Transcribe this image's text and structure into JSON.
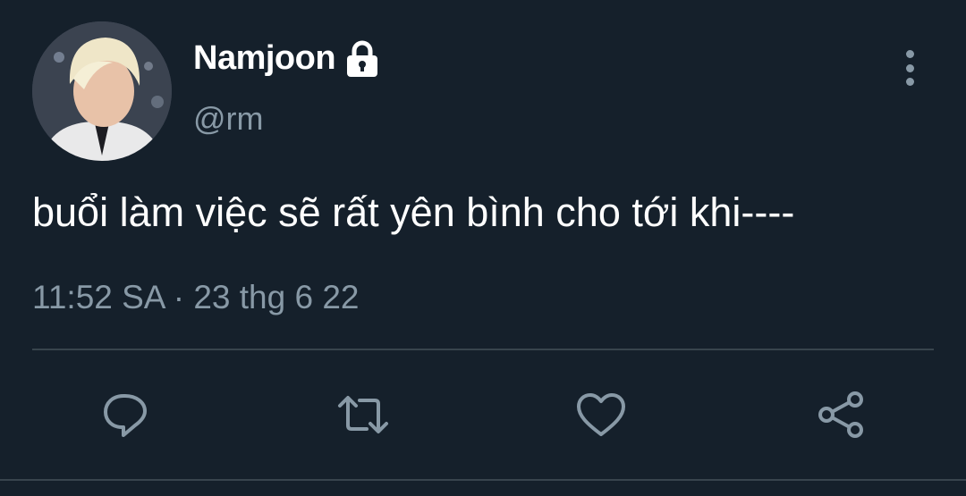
{
  "tweet": {
    "display_name": "Namjoon",
    "handle": "@rm",
    "protected_icon": "lock-icon",
    "text": "buổi làm việc sẽ rất yên bình cho tới khi----",
    "timestamp": "11:52 SA · 23 thg 6 22"
  },
  "actions": [
    {
      "name": "reply",
      "icon": "reply-icon"
    },
    {
      "name": "retweet",
      "icon": "retweet-icon"
    },
    {
      "name": "like",
      "icon": "heart-icon"
    },
    {
      "name": "share",
      "icon": "share-icon"
    }
  ],
  "colors": {
    "background": "#15202b",
    "secondary_text": "#8899a6",
    "divider": "#38444d"
  }
}
